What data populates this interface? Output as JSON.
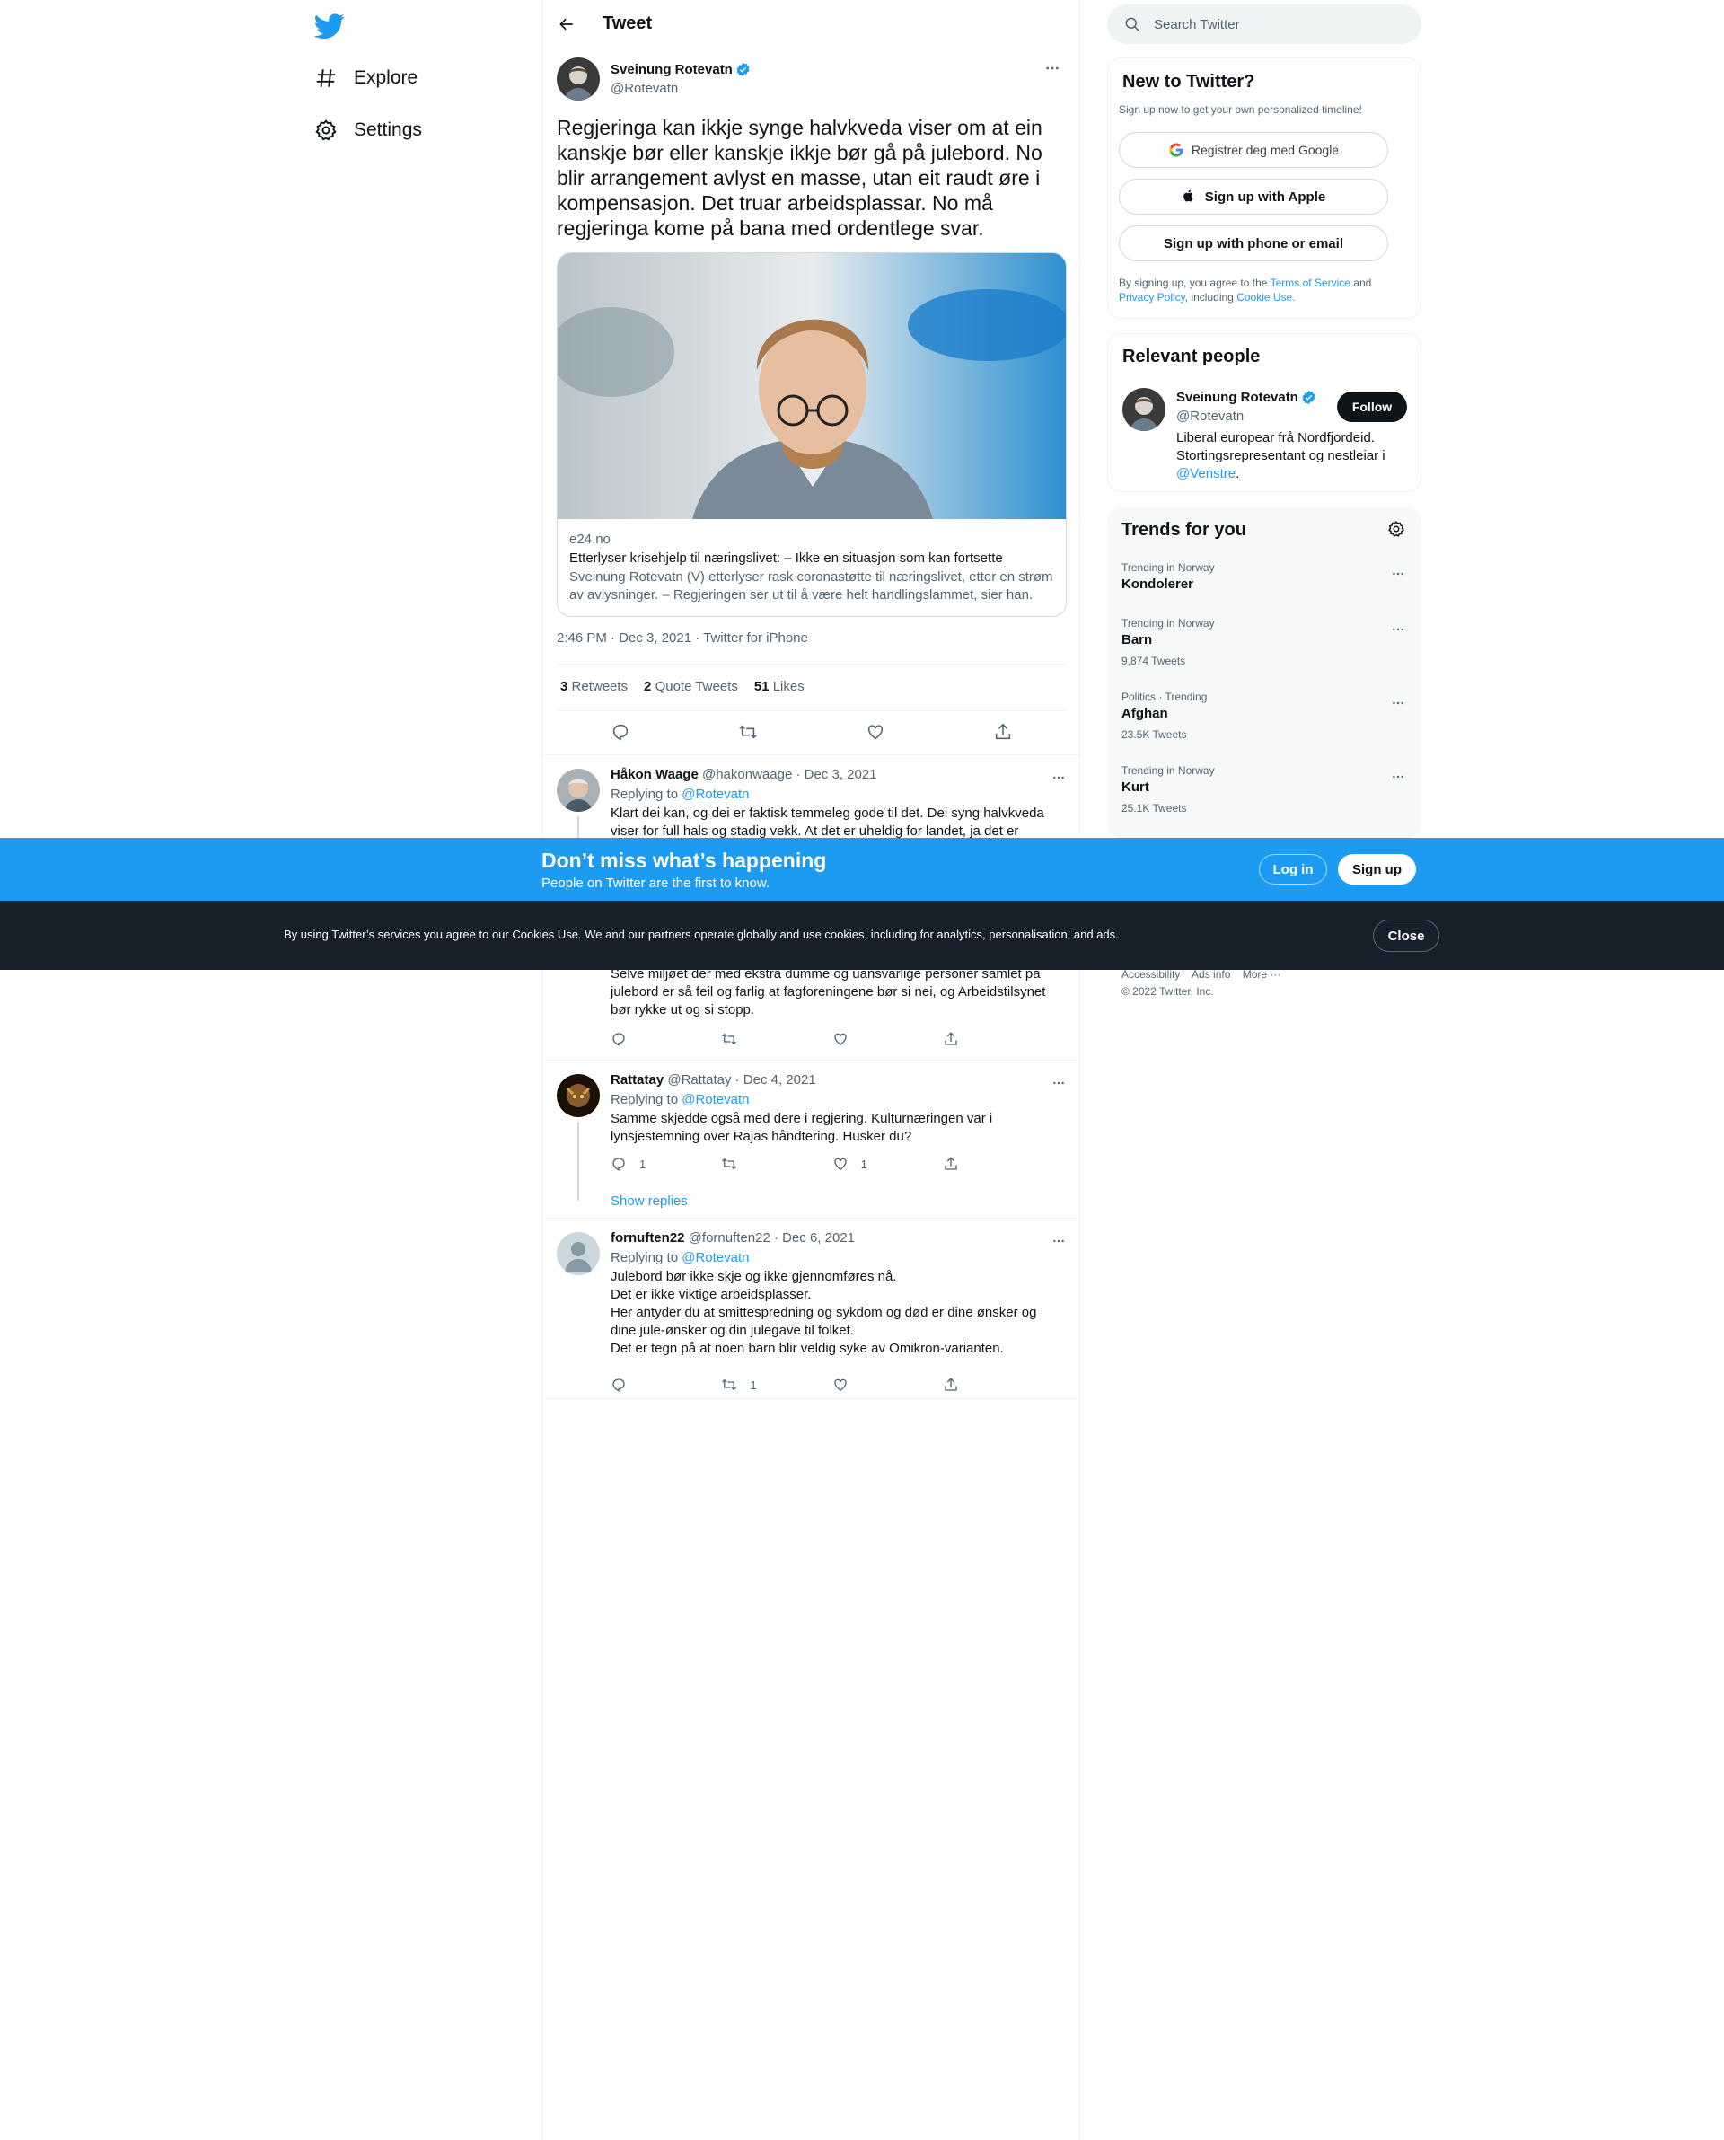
{
  "nav": {
    "logo_icon": "twitter-bird-icon",
    "items": [
      {
        "label": "Explore",
        "icon": "hashtag-icon"
      },
      {
        "label": "Settings",
        "icon": "gear-icon"
      }
    ]
  },
  "main": {
    "title": "Tweet",
    "tweet": {
      "author_name": "Sveinung Rotevatn",
      "author_handle": "@Rotevatn",
      "text": "Regjeringa kan ikkje synge halvkveda viser om at ein kanskje bør eller kanskje ikkje bør gå på julebord. No blir arrangement avlyst en masse, utan eit raudt øre i kompensasjon. Det truar arbeidsplassar. No må regjeringa kome på bana med ordentlege svar.",
      "card": {
        "domain": "e24.no",
        "title": "Etterlyser krisehjelp til næringslivet: – Ikke en situasjon som kan fortsette",
        "description": "Sveinung Rotevatn (V) etterlyser rask coronastøtte til næringslivet, etter en strøm av avlysninger. – Regjeringen ser ut til å være helt handlingslammet, sier han."
      },
      "timestamp": "2:46 PM · Dec 3, 2021 · Twitter for iPhone",
      "stats": {
        "retweets": "3",
        "retweets_label": "Retweets",
        "quotes": "2",
        "quotes_label": "Quote Tweets",
        "likes": "51",
        "likes_label": "Likes"
      }
    },
    "replies": [
      {
        "name": "Håkon Waage",
        "meta": "@hakonwaage · Dec 3, 2021",
        "replying_prefix": "Replying to",
        "replying_to": "@Rotevatn",
        "text_top": "Klart dei kan, og dei er faktisk temmeleg gode til det. Dei syng halvkveda viser for full hals og stadig vekk. At det er uheldig for landet, ja det er",
        "text_bottom": "Selve miljøet der med ekstra dumme og uansvarlige personer samlet på julebord er så feil og farlig at fagforeningene bør si nei, og Arbeidstilsynet bør rykke ut og si stopp."
      },
      {
        "name": "Rattatay",
        "meta": "@Rattatay · Dec 4, 2021",
        "replying_prefix": "Replying to",
        "replying_to": "@Rotevatn",
        "text": "Samme skjedde også med dere i regjering. Kulturnæringen var i lynsjestemning over Rajas håndtering. Husker du?",
        "reply_count": "1",
        "like_count": "1",
        "show_replies": "Show replies"
      },
      {
        "name": "fornuften22",
        "meta": "@fornuften22 · Dec 6, 2021",
        "replying_prefix": "Replying to",
        "replying_to": "@Rotevatn",
        "lines": [
          "Julebord bør ikke skje og ikke gjennomføres nå.",
          "Det er ikke viktige arbeidsplasser.",
          "Her antyder du at smittespredning og sykdom og død er dine ønsker og dine jule-ønsker og din julegave til folket.",
          "Det er tegn på at noen barn blir veldig syke av Omikron-varianten."
        ],
        "retweet_count": "1"
      }
    ]
  },
  "right": {
    "search_placeholder": "Search Twitter",
    "signup": {
      "title": "New to Twitter?",
      "subtitle": "Sign up now to get your own personalized timeline!",
      "google_label": "Registrer deg med Google",
      "apple_label": "Sign up with Apple",
      "phone_label": "Sign up with phone or email",
      "legal_prefix": "By signing up, you agree to the",
      "terms": "Terms of Service",
      "and": "and",
      "privacy": "Privacy Policy",
      "including": ", including",
      "cookie": "Cookie Use."
    },
    "relevant": {
      "title": "Relevant people",
      "name": "Sveinung Rotevatn",
      "handle": "@Rotevatn",
      "follow_label": "Follow",
      "bio": "Liberal europear frå Nordfjordeid. Stortingsrepresentant og nestleiar i",
      "bio_link": "@Venstre",
      "bio_end": "."
    },
    "trends": {
      "title": "Trends for you",
      "items": [
        {
          "meta": "Trending in Norway",
          "name": "Kondolerer",
          "count": ""
        },
        {
          "meta": "Trending in Norway",
          "name": "Barn",
          "count": "9,874 Tweets"
        },
        {
          "meta": "Politics · Trending",
          "name": "Afghan",
          "count": "23.5K Tweets"
        },
        {
          "meta": "Trending in Norway",
          "name": "Kurt",
          "count": "25.1K Tweets"
        }
      ]
    },
    "footer": {
      "links": [
        "Accessibility",
        "Ads info",
        "More ···"
      ],
      "copyright": "© 2022 Twitter, Inc."
    }
  },
  "banner": {
    "title": "Don’t miss what’s happening",
    "subtitle": "People on Twitter are the first to know.",
    "login_label": "Log in",
    "signup_label": "Sign up"
  },
  "cookie": {
    "text": "By using Twitter’s services you agree to our Cookies Use. We and our partners operate globally and use cookies, including for analytics, personalisation, and ads.",
    "close_label": "Close"
  },
  "colors": {
    "accent": "#1d9bf0",
    "text": "#0f1419",
    "muted": "#536471",
    "cookie_bg": "#15202b"
  }
}
